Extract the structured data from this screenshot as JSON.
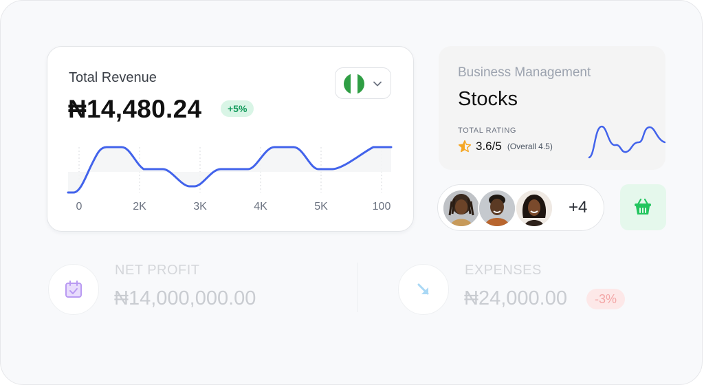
{
  "revenue": {
    "title": "Total Revenue",
    "amount": "₦14,480.24",
    "change_badge": "+5%",
    "currency_flag": "nigeria-flag-icon",
    "line_color": "#4263eb",
    "x_ticks": [
      "0",
      "2K",
      "3K",
      "4K",
      "5K",
      "100"
    ]
  },
  "stocks": {
    "subtitle": "Business Management",
    "title": "Stocks",
    "rating_label": "TOTAL RATING",
    "rating_value": "3.6/5",
    "rating_overall": "(Overall 4.5)",
    "star_icon": "half-star-icon",
    "spark_color": "#4263eb"
  },
  "team": {
    "extra_count": "+4",
    "avatars": [
      "avatar-1",
      "avatar-2",
      "avatar-3"
    ]
  },
  "basket": {
    "icon": "basket-icon",
    "color": "#22c55e"
  },
  "net_profit": {
    "label": "NET PROFIT",
    "value": "₦14,000,000.00",
    "icon": "calendar-check-icon"
  },
  "expenses": {
    "label": "EXPENSES",
    "value": "₦24,000.00",
    "change_badge": "-3%",
    "icon": "arrow-down-right-icon"
  }
}
